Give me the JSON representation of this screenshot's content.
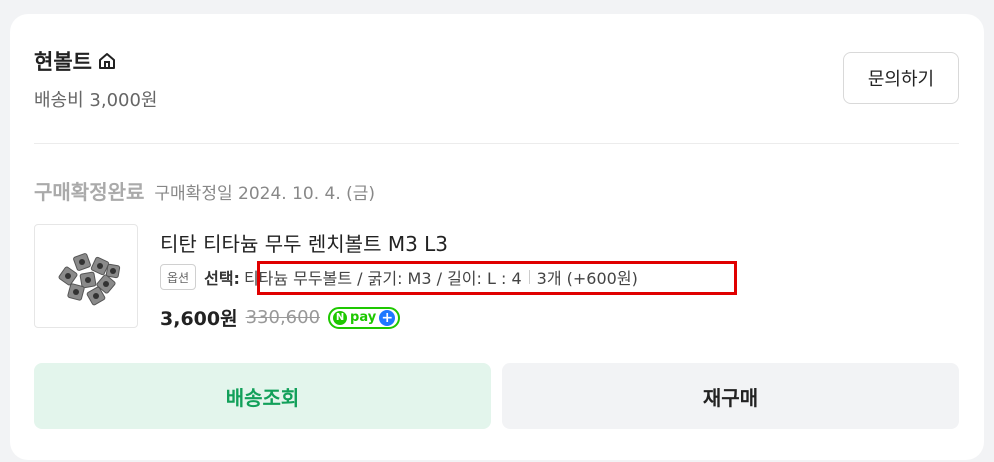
{
  "seller": {
    "name": "현볼트",
    "home_icon": "home-icon",
    "shipping_fee": "배송비 3,000원",
    "inquiry_label": "문의하기"
  },
  "order": {
    "status": "구매확정완료",
    "confirm_date": "구매확정일 2024. 10. 4. (금)"
  },
  "product": {
    "title": "티탄 티타늄 무두 렌치볼트 M3 L3",
    "option_badge": "옵션",
    "option_select_label": "선택:",
    "option_value": "티타늄 무두볼트 / 굵기: M3 / 길이: L : 4",
    "quantity_text": "3개 (+600원)",
    "price": "3,600원",
    "original_price": "330,600",
    "npay": {
      "n": "N",
      "text": "pay",
      "plus": "+",
      "colors": {
        "green": "#1ec800",
        "blue": "#1e78ff"
      }
    }
  },
  "actions": {
    "track_label": "배송조회",
    "rebuy_label": "재구매"
  },
  "colors": {
    "accent_green": "#12a05a",
    "highlight_red": "#e00000"
  }
}
